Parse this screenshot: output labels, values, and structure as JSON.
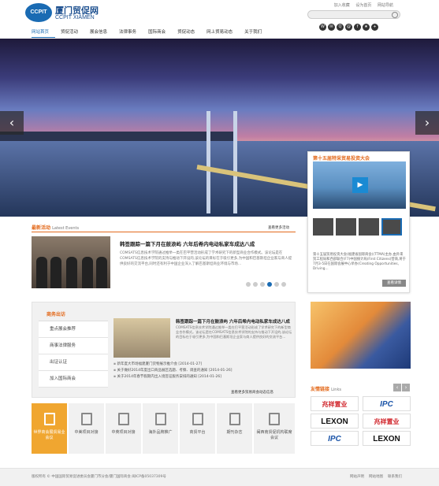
{
  "header": {
    "logo_badge": "CCPIT",
    "logo_cn": "厦门贸促网",
    "logo_en": "CCPIT XIAMEN",
    "top_links": [
      "加入收藏",
      "设为首页",
      "网站导航"
    ],
    "social_icons": [
      "weibo-icon",
      "wechat-icon",
      "qq-icon",
      "mail-icon",
      "facebook-icon",
      "star-icon",
      "share-icon"
    ]
  },
  "nav": {
    "items": [
      "网站首页",
      "贸促活动",
      "展会信息",
      "法律事务",
      "国际商会",
      "贸促动态",
      "网上贸易动态",
      "关于我们"
    ]
  },
  "banner": {
    "prev_label": "‹",
    "next_label": "›"
  },
  "events": {
    "title": "最新活动",
    "title_en": "Latest Events",
    "more": "查看更多活动",
    "headline": "韩签跟踪一篇下月在鼓浪屿 六年后希内电动私家车成达八成",
    "summary": "COMSATS信息技术学院通过推举一类在巴平营活动形成了学术研究下的新型商业合作模式。该论坛是在COMSATS信息技术学院的支持与推动下开设的,该论坛的目标在于吸引更多,为中国和巴基斯坦企业家与商人提供良好的交流平台,同时还有利于中国企业深入了解巴基斯坦商业环境与市场...",
    "dots": 6,
    "active_dot": 3
  },
  "video": {
    "title": "第十五届特采贸易投资大会",
    "play_label": "▶",
    "summary": "第十五届贸易投资大会(福建省国际商会)(TTMA)主办,由外来贸工程局和西部联合(F7)中国统计局(First Citizens)营商,将于7月3-5日在国际会展中心举办(Creating Opportunities, Driving...",
    "button": "查看详情"
  },
  "business": {
    "menu_head": "商务出访",
    "menu_items": [
      "重点展会推荐",
      "商事法律服务",
      "出证认证",
      "加入国际商会"
    ],
    "headline": "韩签跟踪一篇下月在鼓浪屿 六年后希内电动私家车成达八成",
    "summary": "COMSATS信息技术学院通过推举一类在巴平营活动形成了学术研究下的新型商业合作模式。该论坛是在COMSATS信息技术学院的支持与推动下开设的,该论坛的目标在于吸引更多,为中国和巴基斯坦企业家与商人提供良好的交流平台...",
    "list": [
      "新年度大市场福建厦门货物展示推介会 [2014-01-27]",
      "关于做好2014年度出口商品展区选题、考察、调查的通知 [2014-01-26]",
      "关于2014年春节假期内出入境签证服务安排的通知 [2014-01-26]"
    ],
    "more": "查看更多贸易商会动态信息"
  },
  "links": {
    "title": "友情链接",
    "title_en": "Links",
    "prev": "‹",
    "next": "›",
    "logos": [
      "兆祥置业",
      "IPC",
      "LEXON",
      "兆祥置业",
      "IPC",
      "LEXON"
    ]
  },
  "tiles": [
    "世界商会展贸易业会议",
    "中美项目对接",
    "中英项目对接",
    "海外品牌推广",
    "商贸平台",
    "期刊杂志",
    "闽西南贸促机构联席会议"
  ],
  "footer": {
    "copyright": "版权所有 © 中国国际贸易促进委员会厦门市分会/厦门国际商会 闽ICP备05037309号",
    "links": [
      "网站声明",
      "网站地图",
      "联系我们"
    ]
  },
  "colors": {
    "brand_blue": "#1a6bb3",
    "accent_orange": "#e36a1c",
    "tile_active": "#f0a630"
  }
}
